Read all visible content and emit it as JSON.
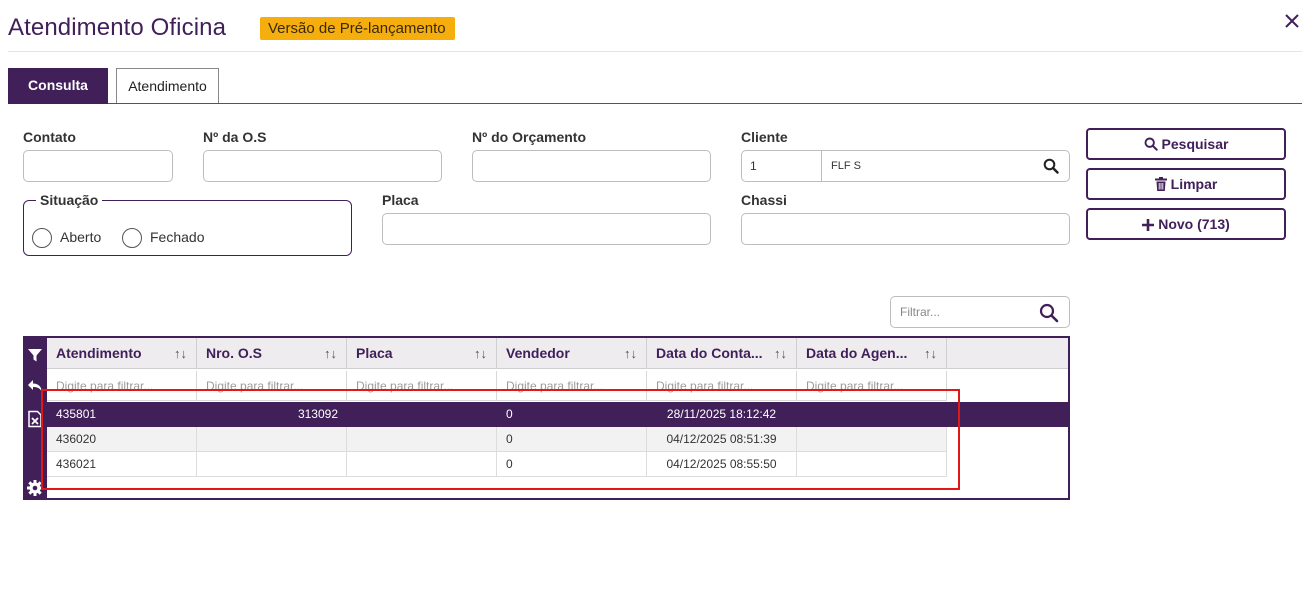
{
  "header": {
    "title": "Atendimento Oficina",
    "badge": "Versão de Pré-lançamento"
  },
  "tabs": [
    {
      "label": "Consulta",
      "active": true
    },
    {
      "label": "Atendimento",
      "active": false
    }
  ],
  "form": {
    "contato_label": "Contato",
    "contato_value": "",
    "os_label": "Nº da O.S",
    "os_value": "",
    "orcamento_label": "Nº do Orçamento",
    "orcamento_value": "",
    "cliente_label": "Cliente",
    "cliente_code": "1",
    "cliente_name": "FLF S",
    "situacao_label": "Situação",
    "situacao_options": [
      "Aberto",
      "Fechado"
    ],
    "placa_label": "Placa",
    "placa_value": "",
    "chassi_label": "Chassi",
    "chassi_value": ""
  },
  "buttons": {
    "pesquisar": "Pesquisar",
    "limpar": "Limpar",
    "novo": "Novo (713)"
  },
  "filter": {
    "placeholder": "Filtrar..."
  },
  "grid": {
    "columns": [
      "Atendimento",
      "Nro. O.S",
      "Placa",
      "Vendedor",
      "Data do Conta...",
      "Data do Agen..."
    ],
    "filter_placeholder": "Digite para filtrar...",
    "rows": [
      {
        "atendimento": "435801",
        "os": "313092",
        "placa": "",
        "vendedor": "0",
        "data_contato": "28/11/2025 18:12:42",
        "data_agenda": ""
      },
      {
        "atendimento": "436020",
        "os": "",
        "placa": "",
        "vendedor": "0",
        "data_contato": "04/12/2025 08:51:39",
        "data_agenda": ""
      },
      {
        "atendimento": "436021",
        "os": "",
        "placa": "",
        "vendedor": "0",
        "data_contato": "04/12/2025 08:55:50",
        "data_agenda": ""
      }
    ]
  },
  "colors": {
    "primary": "#41205a",
    "badge": "#f6ad0e",
    "highlight": "#e01818"
  },
  "icons": [
    "close-icon",
    "search-icon",
    "trash-icon",
    "plus-icon",
    "filter-icon",
    "undo-icon",
    "excel-icon",
    "gear-icon",
    "sort-icon"
  ]
}
